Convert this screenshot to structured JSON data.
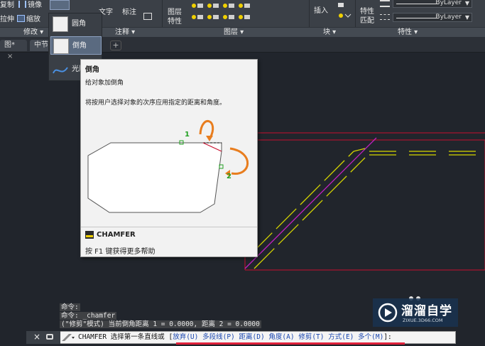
{
  "ribbon": {
    "row1": {
      "copy": "复制",
      "mirror": "镜像",
      "text": "文字",
      "dimension": "标注",
      "layer": "图层",
      "insert": "插入",
      "properties": "特性",
      "bylayer1": "ByLayer",
      "bylayer2": "ByLayer"
    },
    "row2": {
      "stretch": "拉伸",
      "scale": "缩放",
      "layer_props": "特性",
      "match": "匹配"
    },
    "panels": {
      "modify": "修改 ▾",
      "annotation": "注释 ▾",
      "layers": "图层 ▾",
      "block": "块 ▾",
      "properties": "特性 ▾"
    }
  },
  "tabs": [
    {
      "label": "图*",
      "close": "×"
    },
    {
      "label": "中节",
      "close": "×"
    }
  ],
  "flyout": {
    "items": [
      "圆角",
      "倒角",
      "光顺"
    ]
  },
  "tooltip": {
    "title": "倒角",
    "subtitle": "给对象加倒角",
    "description": "将按用户选择对象的次序应用指定的距离和角度。",
    "label1": "1",
    "label2": "2",
    "command": "CHAMFER",
    "help": "按 F1 键获得更多帮助"
  },
  "history": {
    "line1": "命令:",
    "line2": "命令: _chamfer",
    "line3": "(\"修剪\"模式) 当前倒角距离 1 = 0.0000, 距离 2 = 0.0000"
  },
  "cmdline": {
    "close": "×",
    "prefix": "CHAMFER 选择第一条直线或 [",
    "opt1": "放弃(U)",
    "opt2": "多段线(P)",
    "opt3": "距离(D)",
    "opt4": "角度(A)",
    "opt5": "修剪(T)",
    "opt6": "方式(E)",
    "opt7": "多个(M)",
    "suffix": "]:"
  },
  "watermark": {
    "title": "溜溜自学",
    "sub": "ZIXUE.3D66.COM"
  },
  "colors": {
    "accent_red": "#c8102e",
    "yellow": "#d6d600",
    "magenta": "#c020c0",
    "orange": "#e87d1e",
    "green": "#22a022"
  }
}
